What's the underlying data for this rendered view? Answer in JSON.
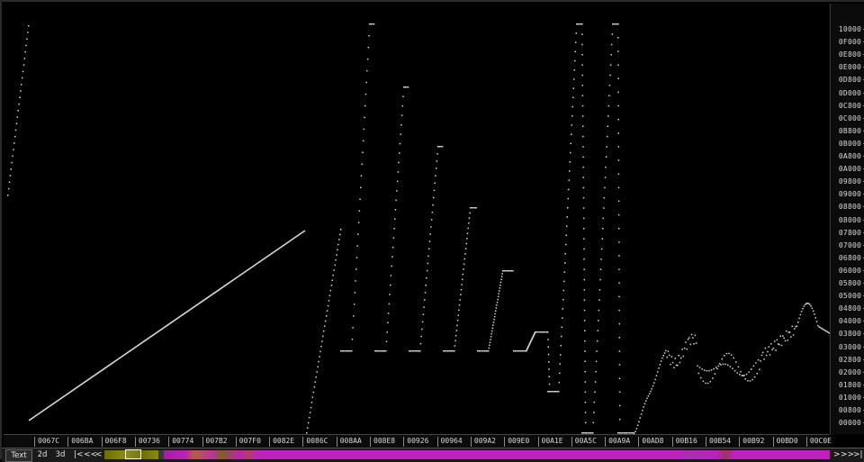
{
  "y_axis": {
    "ticks": [
      "10000",
      "0F000",
      "0E800",
      "0E000",
      "0D800",
      "0D000",
      "0C800",
      "0C000",
      "0B800",
      "0B000",
      "0A800",
      "0A000",
      "09800",
      "09000",
      "08800",
      "08000",
      "07800",
      "07000",
      "06800",
      "06000",
      "05800",
      "05000",
      "04800",
      "04000",
      "03800",
      "03000",
      "02800",
      "02000",
      "01800",
      "01000",
      "00800",
      "00000"
    ]
  },
  "x_axis": {
    "ticks": [
      "0067C",
      "006BA",
      "006F8",
      "00736",
      "00774",
      "007B2",
      "007F0",
      "0082E",
      "0086C",
      "008AA",
      "008E8",
      "00926",
      "00964",
      "009A2",
      "009E0",
      "00A1E",
      "00A5C",
      "00A9A",
      "00AD8",
      "00B16",
      "00B54",
      "00B92",
      "00BD0",
      "00C0E"
    ]
  },
  "toolbar": {
    "text_label": "Text",
    "mode_2d_label": "2d",
    "mode_3d_label": "3d",
    "nav_first": "|<",
    "nav_back_fast": "<<",
    "nav_back": "<",
    "nav_forward": ">",
    "nav_forward_fast": ">>",
    "nav_last": ">|"
  },
  "colors": {
    "background": "#000000",
    "points": "#d8d8d8",
    "overview_magenta": "#c020c0",
    "overview_olive": "#6b6b00"
  }
}
